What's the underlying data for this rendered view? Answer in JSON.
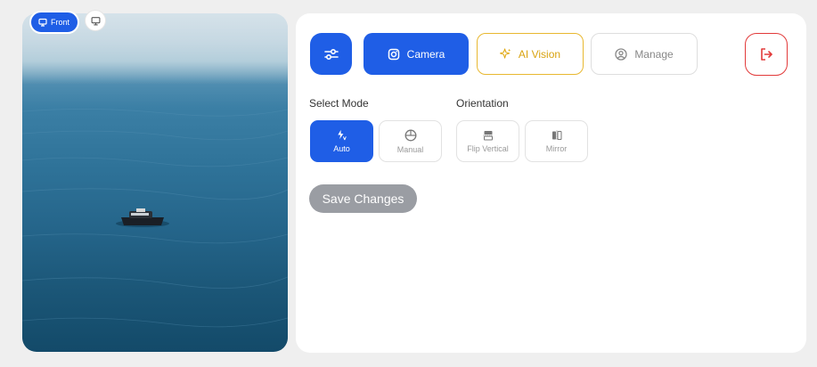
{
  "preview": {
    "front_label": "Front"
  },
  "toolbar": {
    "camera_label": "Camera",
    "ai_vision_label": "AI Vision",
    "manage_label": "Manage"
  },
  "settings": {
    "select_mode_label": "Select Mode",
    "orientation_label": "Orientation",
    "modes": [
      {
        "label": "Auto",
        "active": true
      },
      {
        "label": "Manual",
        "active": false
      }
    ],
    "orientation_options": [
      {
        "label": "Flip Vertical",
        "active": false
      },
      {
        "label": "Mirror",
        "active": false
      }
    ],
    "save_label": "Save Changes"
  },
  "colors": {
    "primary": "#1f5ee6",
    "ai_vision_accent": "#d9a310",
    "logout": "#e23a3a",
    "save_disabled": "#9a9da3"
  },
  "icons": {
    "settings": "sliders-icon",
    "camera": "instagram-camera-icon",
    "ai_vision": "sparkle-icon",
    "manage": "user-circle-icon",
    "logout": "logout-icon",
    "auto": "auto-flash-icon",
    "manual": "globe-icon",
    "flip_vertical": "flip-vertical-icon",
    "mirror": "mirror-icon",
    "front": "monitor-icon",
    "alt_view": "monitor-icon"
  }
}
